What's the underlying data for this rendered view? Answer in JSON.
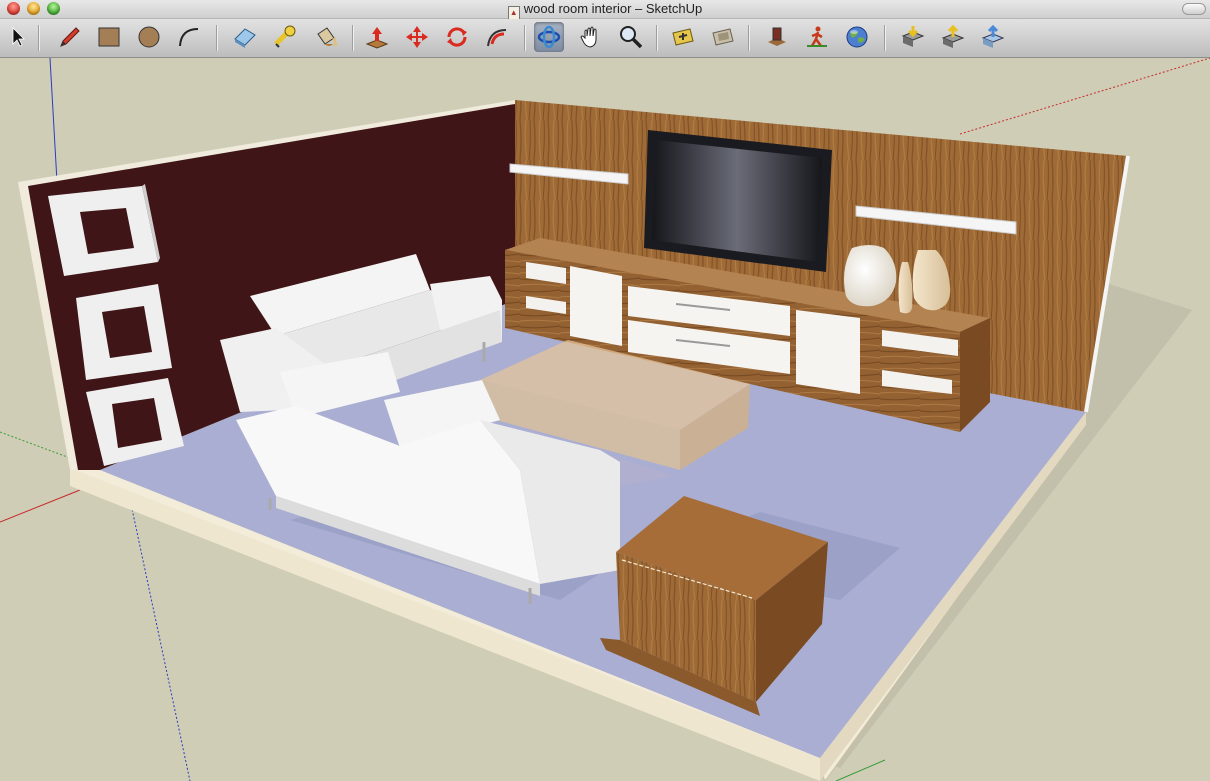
{
  "window": {
    "title": "wood room interior – SketchUp",
    "doc_icon": "sketchup-document-icon"
  },
  "toolbar": {
    "tools": [
      {
        "id": "select",
        "icon": "arrow-cursor-icon",
        "label": "Select"
      },
      {
        "id": "pencil",
        "icon": "pencil-icon",
        "label": "Line"
      },
      {
        "id": "rectangle",
        "icon": "rectangle-icon",
        "label": "Rectangle"
      },
      {
        "id": "circle",
        "icon": "circle-icon",
        "label": "Circle"
      },
      {
        "id": "arc",
        "icon": "arc-icon",
        "label": "Arc"
      },
      {
        "id": "eraser",
        "icon": "eraser-icon",
        "label": "Eraser"
      },
      {
        "id": "tape",
        "icon": "tape-measure-icon",
        "label": "Tape Measure"
      },
      {
        "id": "paint",
        "icon": "paint-bucket-icon",
        "label": "Paint Bucket"
      },
      {
        "id": "pushpull",
        "icon": "push-pull-icon",
        "label": "Push/Pull"
      },
      {
        "id": "move",
        "icon": "move-icon",
        "label": "Move"
      },
      {
        "id": "rotate",
        "icon": "rotate-icon",
        "label": "Rotate"
      },
      {
        "id": "followme",
        "icon": "follow-me-icon",
        "label": "Follow Me"
      },
      {
        "id": "orbit",
        "icon": "orbit-icon",
        "label": "Orbit",
        "active": true
      },
      {
        "id": "pan",
        "icon": "hand-pan-icon",
        "label": "Pan"
      },
      {
        "id": "zoom",
        "icon": "magnifier-zoom-icon",
        "label": "Zoom"
      },
      {
        "id": "previous",
        "icon": "previous-view-icon",
        "label": "Previous"
      },
      {
        "id": "zoomext",
        "icon": "zoom-extents-icon",
        "label": "Zoom Extents"
      },
      {
        "id": "components",
        "icon": "get-models-icon",
        "label": "Get Models"
      },
      {
        "id": "walk",
        "icon": "walk-icon",
        "label": "Walk"
      },
      {
        "id": "earth",
        "icon": "globe-icon",
        "label": "Google Earth"
      },
      {
        "id": "upload",
        "icon": "download-model-icon",
        "label": "Download"
      },
      {
        "id": "share",
        "icon": "share-model-icon",
        "label": "Share Model"
      },
      {
        "id": "export",
        "icon": "export-icon",
        "label": "Export"
      }
    ]
  },
  "colors": {
    "viewport_bg": "#cfcdb6",
    "wood": "#9a6532",
    "wood_dark": "#7a4a22",
    "left_wall": "#3f1517",
    "floor": "#a9aed2",
    "sofa": "#f2f2f2",
    "table_glass": "#e9c89c",
    "axis_red": "#c62a2a",
    "axis_green": "#3a9b3a",
    "axis_blue": "#2c3cc0"
  },
  "scene": {
    "name": "wood room interior"
  }
}
